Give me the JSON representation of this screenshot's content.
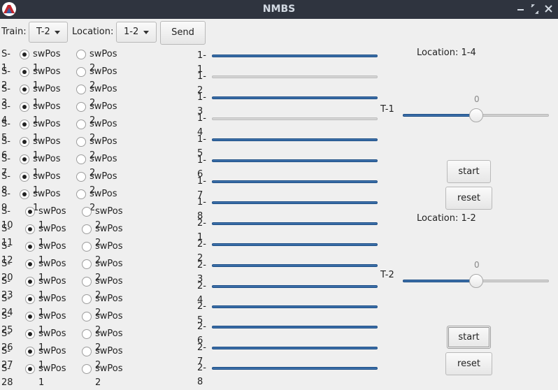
{
  "window": {
    "title": "NMBS"
  },
  "toolbar": {
    "train_label": "Train:",
    "train_value": "T-2",
    "location_label": "Location:",
    "location_value": "1-2",
    "send_label": "Send"
  },
  "switch_option1": "swPos 1",
  "switch_option2": "swPos 2",
  "switches": [
    {
      "label": "S-1",
      "selected": 1
    },
    {
      "label": "S-2",
      "selected": 1
    },
    {
      "label": "S-3",
      "selected": 1
    },
    {
      "label": "S-4",
      "selected": 1
    },
    {
      "label": "S-5",
      "selected": 1
    },
    {
      "label": "S-6",
      "selected": 1
    },
    {
      "label": "S-7",
      "selected": 1
    },
    {
      "label": "S-8",
      "selected": 1
    },
    {
      "label": "S-9",
      "selected": 1
    },
    {
      "label": "S-10",
      "selected": 1
    },
    {
      "label": "S-11",
      "selected": 1
    },
    {
      "label": "S-12",
      "selected": 1
    },
    {
      "label": "S-20",
      "selected": 1
    },
    {
      "label": "S-23",
      "selected": 1
    },
    {
      "label": "S-24",
      "selected": 1
    },
    {
      "label": "S-25",
      "selected": 1
    },
    {
      "label": "S-26",
      "selected": 1
    },
    {
      "label": "S-27",
      "selected": 1
    },
    {
      "label": "S-28",
      "selected": 1
    }
  ],
  "tracks": [
    {
      "label": "1-1",
      "active": true
    },
    {
      "label": "1-2",
      "active": false
    },
    {
      "label": "1-3",
      "active": true
    },
    {
      "label": "1-4",
      "active": false
    },
    {
      "label": "1-5",
      "active": true
    },
    {
      "label": "1-6",
      "active": true
    },
    {
      "label": "1-7",
      "active": true
    },
    {
      "label": "1-8",
      "active": true
    },
    {
      "label": "2-1",
      "active": true
    },
    {
      "label": "2-2",
      "active": true
    },
    {
      "label": "2-3",
      "active": true
    },
    {
      "label": "2-4",
      "active": true
    },
    {
      "label": "2-5",
      "active": true
    },
    {
      "label": "2-6",
      "active": true
    },
    {
      "label": "2-7",
      "active": true
    },
    {
      "label": "2-8",
      "active": true
    }
  ],
  "trains": [
    {
      "name": "T-1",
      "location": "Location: 1-4",
      "speed": 0,
      "speed_fraction": 0.5,
      "start_label": "start",
      "reset_label": "reset"
    },
    {
      "name": "T-2",
      "location": "Location: 1-2",
      "speed": 0,
      "speed_fraction": 0.5,
      "start_label": "start",
      "reset_label": "reset"
    }
  ],
  "colors": {
    "accent": "#3b6ea8",
    "titlebar": "#2f343f"
  }
}
